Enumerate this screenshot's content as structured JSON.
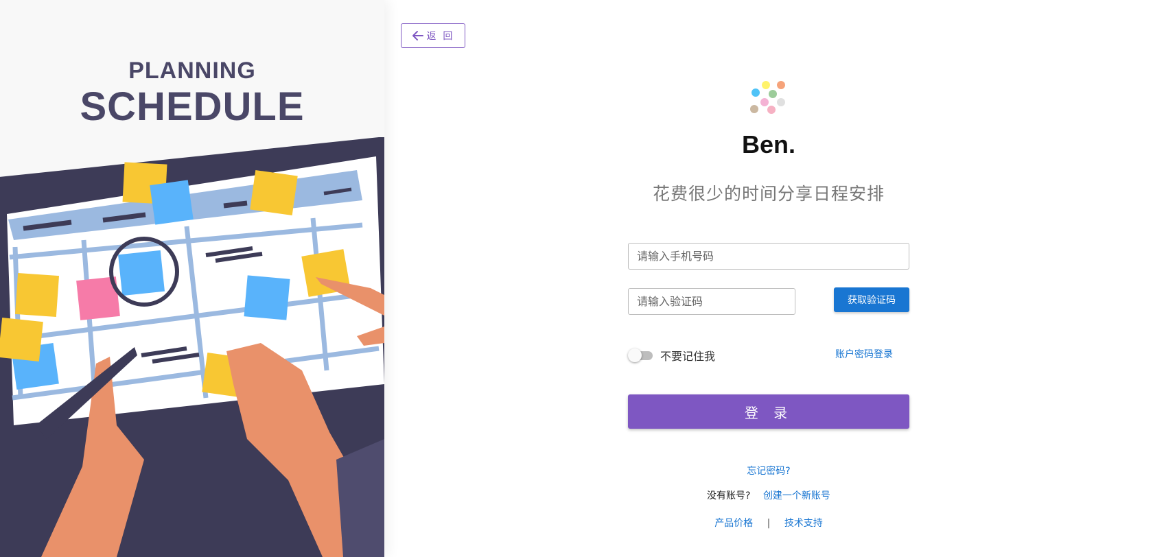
{
  "hero": {
    "title_small": "PLANNING",
    "title_big": "SCHEDULE"
  },
  "back_button": {
    "label": "返 回",
    "icon": "arrow-left-icon"
  },
  "brand": {
    "logo_icon": "colored-dots-logo-icon",
    "name": "Ben.",
    "tagline": "花费很少的时间分享日程安排"
  },
  "form": {
    "phone_placeholder": "请输入手机号码",
    "phone_value": "",
    "code_placeholder": "请输入验证码",
    "code_value": "",
    "get_code_label": "获取验证码",
    "remember_label": "不要记住我",
    "remember_on": false,
    "password_login_label": "账户密码登录",
    "submit_label": "登 录"
  },
  "links": {
    "forgot_password": "忘记密码?",
    "no_account": "没有账号?",
    "create_account": "创建一个新账号",
    "pricing": "产品价格",
    "separator": "|",
    "support": "技术支持"
  },
  "colors": {
    "primary": "#7e57c2",
    "accent": "#1976d2",
    "hero_text": "#4a4767"
  }
}
